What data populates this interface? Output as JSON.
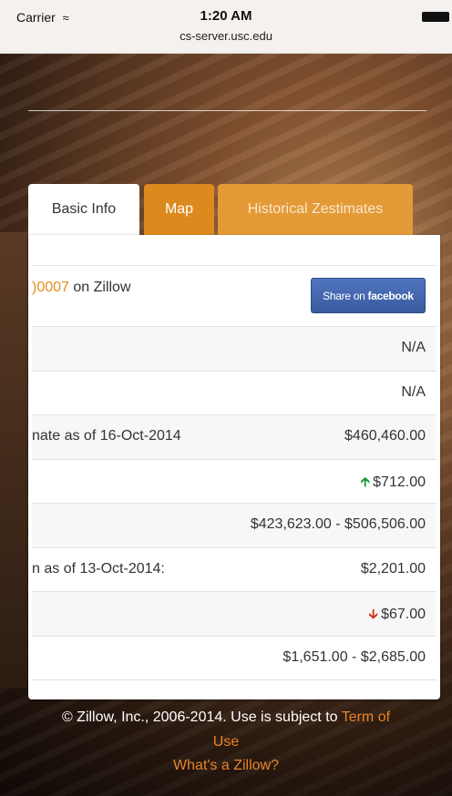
{
  "status_bar": {
    "carrier": "Carrier",
    "time": "1:20 AM",
    "url": "cs-server.usc.edu"
  },
  "tabs": [
    {
      "label": "Basic Info",
      "active": true
    },
    {
      "label": "Map",
      "active": false
    },
    {
      "label": "Historical Zestimates",
      "active": false
    }
  ],
  "header_row": {
    "zpid_fragment": ")0007",
    "on_zillow": " on Zillow",
    "share_prefix": "Share on ",
    "share_brand": "facebook"
  },
  "rows": [
    {
      "label": "",
      "value": "N/A"
    },
    {
      "label": "",
      "value": "N/A"
    },
    {
      "label": "nate as of 16-Oct-2014",
      "value": "$460,460.00"
    },
    {
      "label": "",
      "value": "$712.00",
      "trend": "up"
    },
    {
      "label": "",
      "value": "$423,623.00 - $506,506.00"
    },
    {
      "label": "n as of 13-Oct-2014:",
      "value": "$2,201.00"
    },
    {
      "label": "",
      "value": "$67.00",
      "trend": "down"
    },
    {
      "label": "",
      "value": "$1,651.00 - $2,685.00"
    }
  ],
  "footer": {
    "copyright": "© Zillow, Inc., 2006-2014. Use is subject to ",
    "terms_link_1": "Term of",
    "terms_link_2": "Use",
    "whats_zillow": "What's a Zillow?"
  },
  "colors": {
    "accent_orange": "#e48a1a",
    "tab_orange": "#dc8a1e",
    "facebook_blue": "#3b5b9e",
    "trend_up": "#1a9c2e",
    "trend_down": "#d2331f"
  },
  "icons": {
    "wifi": "wifi-icon",
    "battery": "battery-icon",
    "trend_up": "arrow-up-icon",
    "trend_down": "arrow-down-icon"
  }
}
